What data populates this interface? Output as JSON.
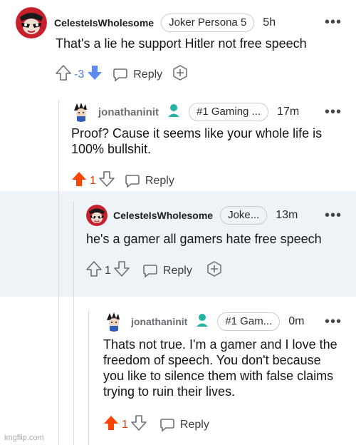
{
  "colors": {
    "upvote_active": "#ff4500",
    "downvote_active": "#5d8bf4",
    "mod_icon": "#24b3a3",
    "band": "#eef3f8",
    "score_neg": "#4f7fe6",
    "score_pos": "#d93900"
  },
  "comments": [
    {
      "username": "CelesteIsWholesome",
      "flair": "Joker Persona 5",
      "time": "5h",
      "body": "That's a lie he support Hitler not free speech",
      "score": "-3",
      "reply_label": "Reply"
    },
    {
      "username": "jonathaninit",
      "flair": "#1 Gaming ...",
      "time": "17m",
      "body": "Proof? Cause it seems like your whole life is 100% bullshit.",
      "score": "1",
      "reply_label": "Reply"
    },
    {
      "username": "CelesteIsWholesome",
      "flair": "Joke...",
      "time": "13m",
      "body": "he's a gamer all gamers hate free speech",
      "score": "1",
      "reply_label": "Reply"
    },
    {
      "username": "jonathaninit",
      "flair": "#1 Gam...",
      "time": "0m",
      "body": "Thats not true. I'm a gamer and I love the freedom of speech. You don't because you like to silence them with false claims trying to ruin their lives.",
      "score": "1",
      "reply_label": "Reply"
    }
  ],
  "more_glyph": "•••",
  "watermark": "imgflip.com"
}
